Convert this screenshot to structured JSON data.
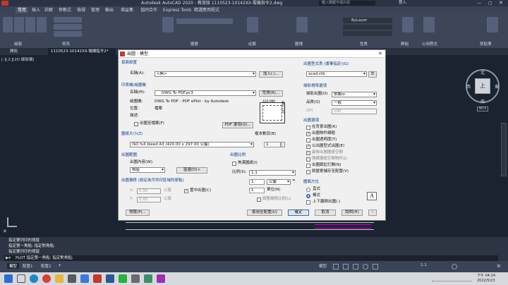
{
  "app": {
    "title": "Autodesk AutoCAD 2020 - 教育版   1110523-10142XX-電機指令2.dwg",
    "search_placeholder": "鍵入關鍵字或片語",
    "user": "登入"
  },
  "ribbon_tabs": [
    "常用",
    "插入",
    "註解",
    "參數式",
    "檢視",
    "管理",
    "輸出",
    "增益集",
    "協同合作",
    "Express Tools",
    "精選應用程式"
  ],
  "ribbon": {
    "bylayer": "ByLayer",
    "panels": [
      "繪製",
      "修改",
      "圖層",
      "註解",
      "圖塊",
      "性質",
      "群組",
      "公用程式",
      "剪貼簿"
    ]
  },
  "doc_tabs": [
    "開始",
    "1110523-10142XX-電機指令2*",
    "+"
  ],
  "viewport": {
    "label": "[-][上][2D 線架構]",
    "viewcube": {
      "north": "北",
      "south": "南",
      "east": "東",
      "west": "西",
      "center": "上",
      "wcs": "WCS"
    }
  },
  "dialog": {
    "title": "出圖 - 模型",
    "page_setup": {
      "section": "頁面設置",
      "name_label": "名稱(A):",
      "name_value": "<無>",
      "add_button": "加入(.)..."
    },
    "printer": {
      "section": "印表機/繪圖機",
      "name_label": "名稱(M):",
      "name_value": "DWG To PDF.pc3",
      "properties_button": "性質(R)...",
      "plotter_label": "繪圖機:",
      "plotter_value": "DWG To PDF - PDF ePlot - by Autodesk",
      "where_label": "位置:",
      "where_value": "檔案",
      "desc_label": "描述:",
      "plot_to_file": "出圖至檔案(F)",
      "pdf_options_button": "PDF 選項(Q)...",
      "preview_width": "420 MM",
      "preview_height": "297 MM"
    },
    "paper_size": {
      "label": "圖紙大小(Z)",
      "value": "ISO full bleed A3 (420.00 x 297.00 公釐)"
    },
    "copies": {
      "label": "複本數目(B)",
      "value": "1"
    },
    "plot_area": {
      "section": "出圖範圍",
      "what_label": "出圖內容(W):",
      "what_value": "視窗",
      "window_button": "窗選(O)<"
    },
    "plot_offset": {
      "section": "出圖偏移 (設定為可列印區域的原點)",
      "x_label": "X:",
      "x_value": "0.00",
      "y_label": "Y:",
      "y_value": "0.00",
      "unit": "公釐",
      "center": "置中出圖(C)"
    },
    "plot_scale": {
      "section": "出圖比例",
      "fit": "佈滿圖紙(I)",
      "scale_label": "比例(S):",
      "scale_value": "1:1",
      "value1": "1",
      "units_value": "公釐",
      "value2": "1",
      "units2": "單位(N)",
      "lineweights": "調整線粗比例(L)"
    },
    "plot_style_table": {
      "label": "出圖型式表 (畫筆指定)(G)",
      "value": "acad.ctb"
    },
    "shaded_viewport": {
      "section": "描影視埠選項",
      "shade_label": "描影出圖(D)",
      "shade_value": "依顯示",
      "quality_label": "品質(Q)",
      "quality_value": "一般",
      "dpi_label": "DPI",
      "dpi_value": "100"
    },
    "plot_options": {
      "section": "出圖選項",
      "items": [
        {
          "label": "在背景出圖(K)",
          "checked": false
        },
        {
          "label": "出圖物件線粗",
          "checked": true
        },
        {
          "label": "出圖透明度(T)",
          "checked": false
        },
        {
          "label": "以出圖型式出圖(E)",
          "checked": true
        },
        {
          "label": "最後出圖圖紙空間",
          "checked": true
        },
        {
          "label": "隱藏圖紙空間物件(J)",
          "checked": false
        },
        {
          "label": "出圖戳記打開(N)",
          "checked": false
        },
        {
          "label": "將變更儲存至配置(V)",
          "checked": false
        }
      ]
    },
    "orientation": {
      "section": "圖面方位",
      "portrait": "直式",
      "landscape": "橫式",
      "upside_down": "上下顛倒出圖(-)",
      "selected": "landscape"
    },
    "buttons": {
      "preview": "預覽(P)...",
      "apply": "套用至配置(U)",
      "ok": "確定",
      "cancel": "取消",
      "help": "說明(H)"
    }
  },
  "command": {
    "history": [
      "指定要列印的視窗",
      "指定第一角點: 指定對角點:",
      "指定要列印的視窗"
    ],
    "prompt": "PLOT 指定第一角點: 指定對角點:"
  },
  "layout_tabs": [
    "模型",
    "配置1",
    "配置2",
    "+"
  ],
  "status": {
    "mode": "模型",
    "scale": "1:1"
  },
  "taskbar": {
    "time": "下午 04:24",
    "date": "2022/5/23"
  },
  "colors": {
    "dialog_bg": "#f0f0f0",
    "viewport_bg": "#1b2230",
    "accent": "#2a6fd0",
    "magenta": "#d300c8"
  }
}
